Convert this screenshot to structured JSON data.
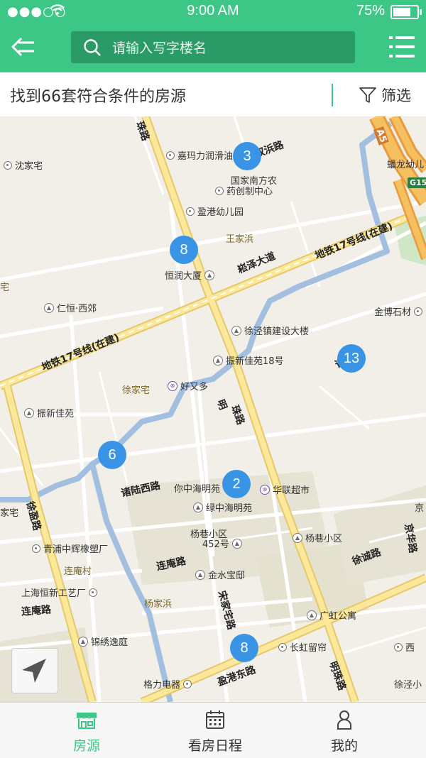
{
  "status_bar": {
    "carrier": "●●●○○",
    "time": "9:00 AM",
    "battery": "75%",
    "battery_level": 0.75
  },
  "header": {
    "back_icon": "back-arrow-icon",
    "search": {
      "placeholder": "请输入写字楼名",
      "value": ""
    },
    "menu_icon": "list-menu-icon"
  },
  "result_bar": {
    "text": "找到66套符合条件的房源",
    "filter_label": "筛选",
    "accent": "#3cc786"
  },
  "map": {
    "clusters": [
      {
        "count": "3"
      },
      {
        "count": "8"
      },
      {
        "count": "13"
      },
      {
        "count": "6"
      },
      {
        "count": "2"
      },
      {
        "count": "8"
      }
    ],
    "roads": {
      "mingzhu1": "明",
      "mingzhu2": "珠路",
      "mingzhu_top": "珠路",
      "mingzhu_bottom": "明珠路",
      "shuangbin": "双浜路",
      "songze": "崧泽大道",
      "metro_top": "地铁17号线(在建)",
      "metro_left": "地铁17号线(在建)",
      "xuying": "徐盈路",
      "zhulu_west": "诸陆西路",
      "lianan": "连庵路",
      "lianan_w": "连庵路",
      "songjiazhai": "宋家宅路",
      "yinggang_east": "盈港东路",
      "xucheng": "徐诚路",
      "jinghua": "京华路",
      "zhuguang": "诸光路"
    },
    "places": {
      "wangjiabang": "王家浜",
      "xujiazhai": "徐家宅",
      "lianancun": "连庵村",
      "yangjiabang": "杨家浜"
    },
    "pois": {
      "shenjiazhai": "沈家宅",
      "jiamali": "嘉玛力润滑油",
      "guojia_nanfang": "国家南方农",
      "guojia_nanfang2": "药创制中心",
      "yinggang_kindergarten": "盈港幼儿园",
      "henrun": "恒润大厦",
      "renheng": "仁恒·西郊",
      "xujing_dev": "徐泾镇建设大楼",
      "zhenxin18": "振新佳苑18号",
      "haoyouduo": "好又多",
      "zhenxin": "振新佳苑",
      "jinbo": "金博石材",
      "ni_zhonghai": "你中海明苑",
      "hualian": "华联超市",
      "lv_zhonghai": "绿中海明苑",
      "yangxiang452": "杨巷小区",
      "yangxiang452b": "452号",
      "yangxiang": "杨巷小区",
      "qingpu": "青浦中辉橡塑厂",
      "shanghai_hengxin": "上海恒新工艺厂",
      "jinshuibao": "金水宝邸",
      "jinxiu": "锦绣逸庭",
      "guanghong": "广虹公寓",
      "changhong": "长虹留帘",
      "geli": "格力电器",
      "xujingxiao": "徐泾小",
      "jiajiazhai": "家宅",
      "zhai_left": "宅",
      "shanglong": "蟠龙幼儿",
      "jing_right": "京",
      "xi_right": "西"
    },
    "highway": {
      "a5": "A5",
      "g15": "G15"
    },
    "locate_icon": "locate-arrow-icon"
  },
  "tab_bar": {
    "tabs": [
      {
        "label": "房源",
        "icon": "storefront-icon",
        "active": true
      },
      {
        "label": "看房日程",
        "icon": "calendar-icon",
        "active": false
      },
      {
        "label": "我的",
        "icon": "user-icon",
        "active": false
      }
    ]
  }
}
